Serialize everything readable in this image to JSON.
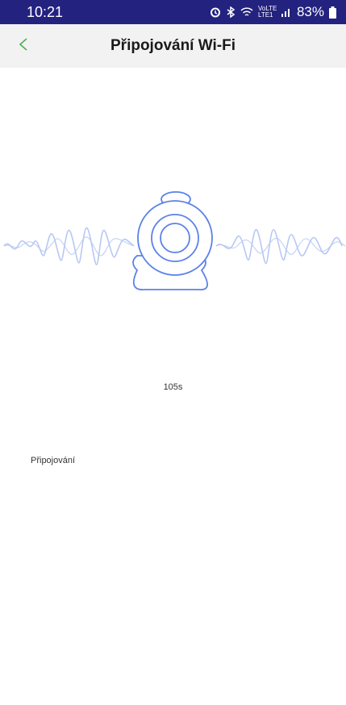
{
  "status_bar": {
    "time": "10:21",
    "network": "VoLTE LTE1",
    "battery": "83%",
    "icons": [
      "alarm-icon",
      "bluetooth-icon",
      "wifi-icon",
      "signal-icon",
      "battery-icon"
    ]
  },
  "header": {
    "back_icon": "chevron-left-icon",
    "title": "Připojování Wi-Fi"
  },
  "illustration": {
    "icon": "webcam-icon",
    "accent": "#5b82e8",
    "wave_color": "#b8c8f2"
  },
  "countdown": "105s",
  "status_label": "Připojování",
  "colors": {
    "status_bar": "#23227f",
    "header_bg": "#f2f2f2",
    "back_arrow": "#4caf50"
  }
}
